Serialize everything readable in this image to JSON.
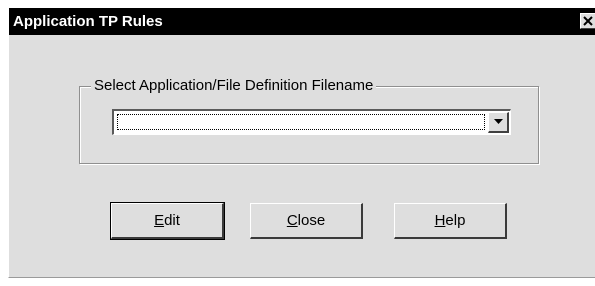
{
  "window": {
    "title": "Application TP Rules"
  },
  "group": {
    "label": "Select Application/File Definition Filename"
  },
  "combo": {
    "value": ""
  },
  "buttons": {
    "edit": {
      "accel": "E",
      "rest": "dit"
    },
    "close": {
      "accel": "C",
      "rest": "lose"
    },
    "help": {
      "accel": "H",
      "rest": "elp"
    }
  },
  "icons": {
    "close": "close-icon",
    "dropdown": "chevron-down-icon"
  },
  "colors": {
    "titlebar": "#000000",
    "title_text": "#ffffff",
    "dialog_face": "#dedede",
    "field_bg": "#ffffff"
  }
}
